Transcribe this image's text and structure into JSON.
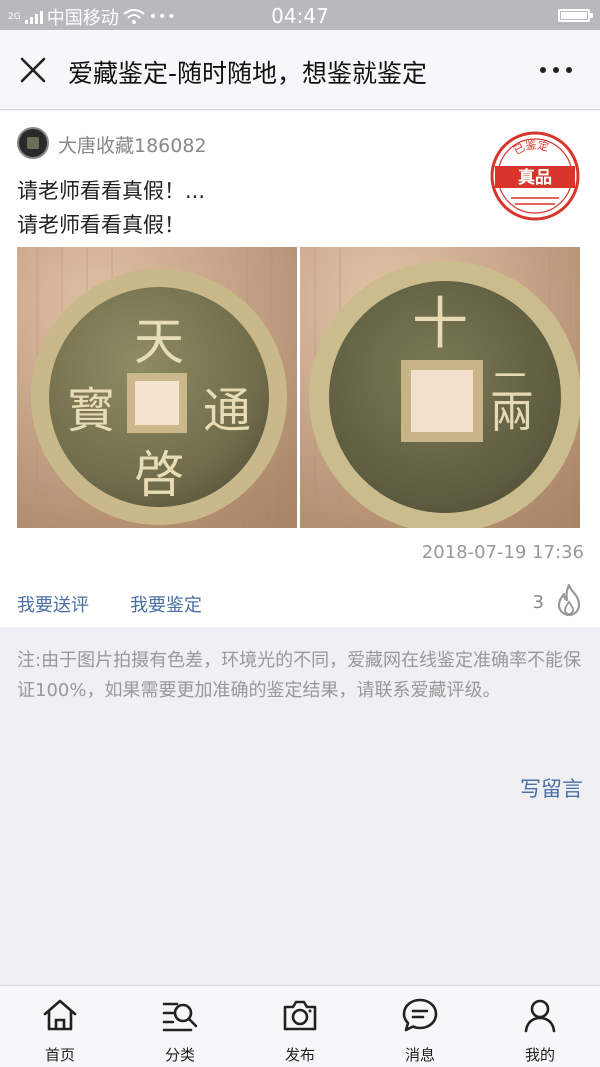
{
  "status_bar": {
    "network_label": "2G",
    "carrier": "中国移动",
    "time": "04:47",
    "more_dots": "•••"
  },
  "nav": {
    "title": "爱藏鉴定-随时随地，想鉴就鉴定",
    "close_icon": "close-icon",
    "more_icon": "more-icon"
  },
  "post": {
    "username": "大唐收藏186082",
    "summary": "请老师看看真假！...",
    "body": "请老师看看真假！",
    "stamp": {
      "top_text": "已鉴定",
      "main_text": "真品",
      "color": "#d9342b"
    },
    "images": [
      {
        "name": "coin-front-photo",
        "glyphs": [
          "天",
          "啓",
          "通",
          "寳"
        ]
      },
      {
        "name": "coin-back-photo",
        "glyphs": [
          "十",
          "一",
          "兩"
        ]
      }
    ],
    "timestamp": "2018-07-19 17:36",
    "actions": {
      "comment": "我要送评",
      "appraise": "我要鉴定"
    },
    "hot_count": "3"
  },
  "notice": {
    "text": "注:由于图片拍摄有色差，环境光的不同，爱藏网在线鉴定准确率不能保证100%，如果需要更加准确的鉴定结果，请联系爱藏评级。",
    "write_comment": "写留言"
  },
  "tab_bar": {
    "items": [
      {
        "label": "首页",
        "icon": "home-icon"
      },
      {
        "label": "分类",
        "icon": "category-search-icon"
      },
      {
        "label": "发布",
        "icon": "camera-icon"
      },
      {
        "label": "消息",
        "icon": "message-icon"
      },
      {
        "label": "我的",
        "icon": "profile-icon"
      }
    ]
  },
  "colors": {
    "link": "#4a6fa5",
    "stamp_red": "#d9342b",
    "muted": "#999999"
  }
}
